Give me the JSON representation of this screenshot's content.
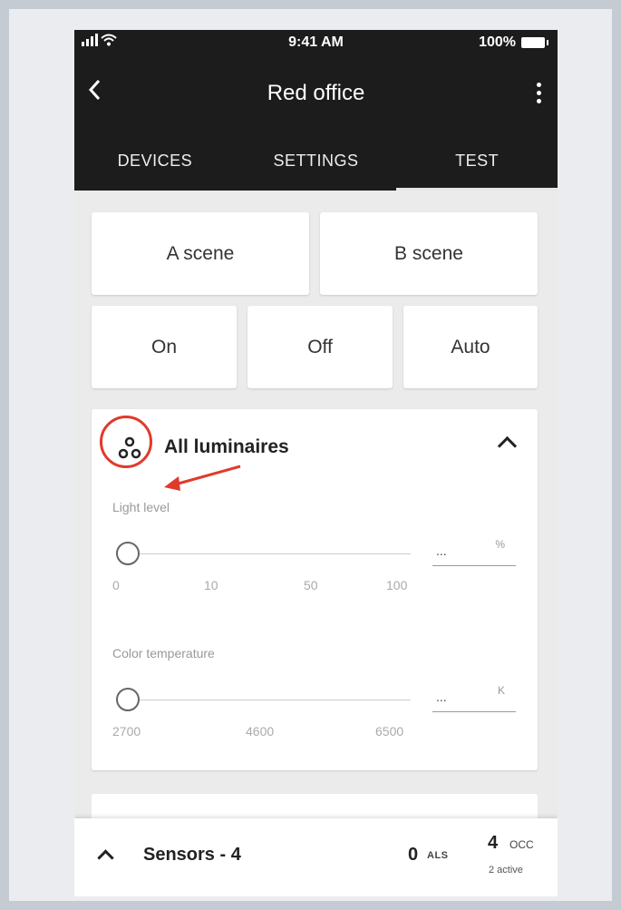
{
  "status": {
    "time": "9:41 AM",
    "battery": "100%"
  },
  "header": {
    "title": "Red office"
  },
  "tabs": [
    {
      "label": "DEVICES"
    },
    {
      "label": "SETTINGS"
    },
    {
      "label": "TEST",
      "active": true
    }
  ],
  "scenes": {
    "a": "A scene",
    "b": "B scene"
  },
  "modes": {
    "on": "On",
    "off": "Off",
    "auto": "Auto"
  },
  "group": {
    "title": "All luminaires",
    "light": {
      "label": "Light level",
      "ticks": [
        "0",
        "10",
        "50",
        "100"
      ],
      "value": "...",
      "unit": "%",
      "level": 0
    },
    "color": {
      "label": "Color temperature",
      "ticks": [
        "2700",
        "4600",
        "6500"
      ],
      "value": "...",
      "unit": "K",
      "level": 0
    }
  },
  "annotation": {
    "color": "#e03a2b"
  },
  "sensors": {
    "title": "Sensors - 4",
    "als_count": "0",
    "als_label": "ALS",
    "occ_count": "4",
    "occ_label": "OCC",
    "active": "2 active"
  }
}
